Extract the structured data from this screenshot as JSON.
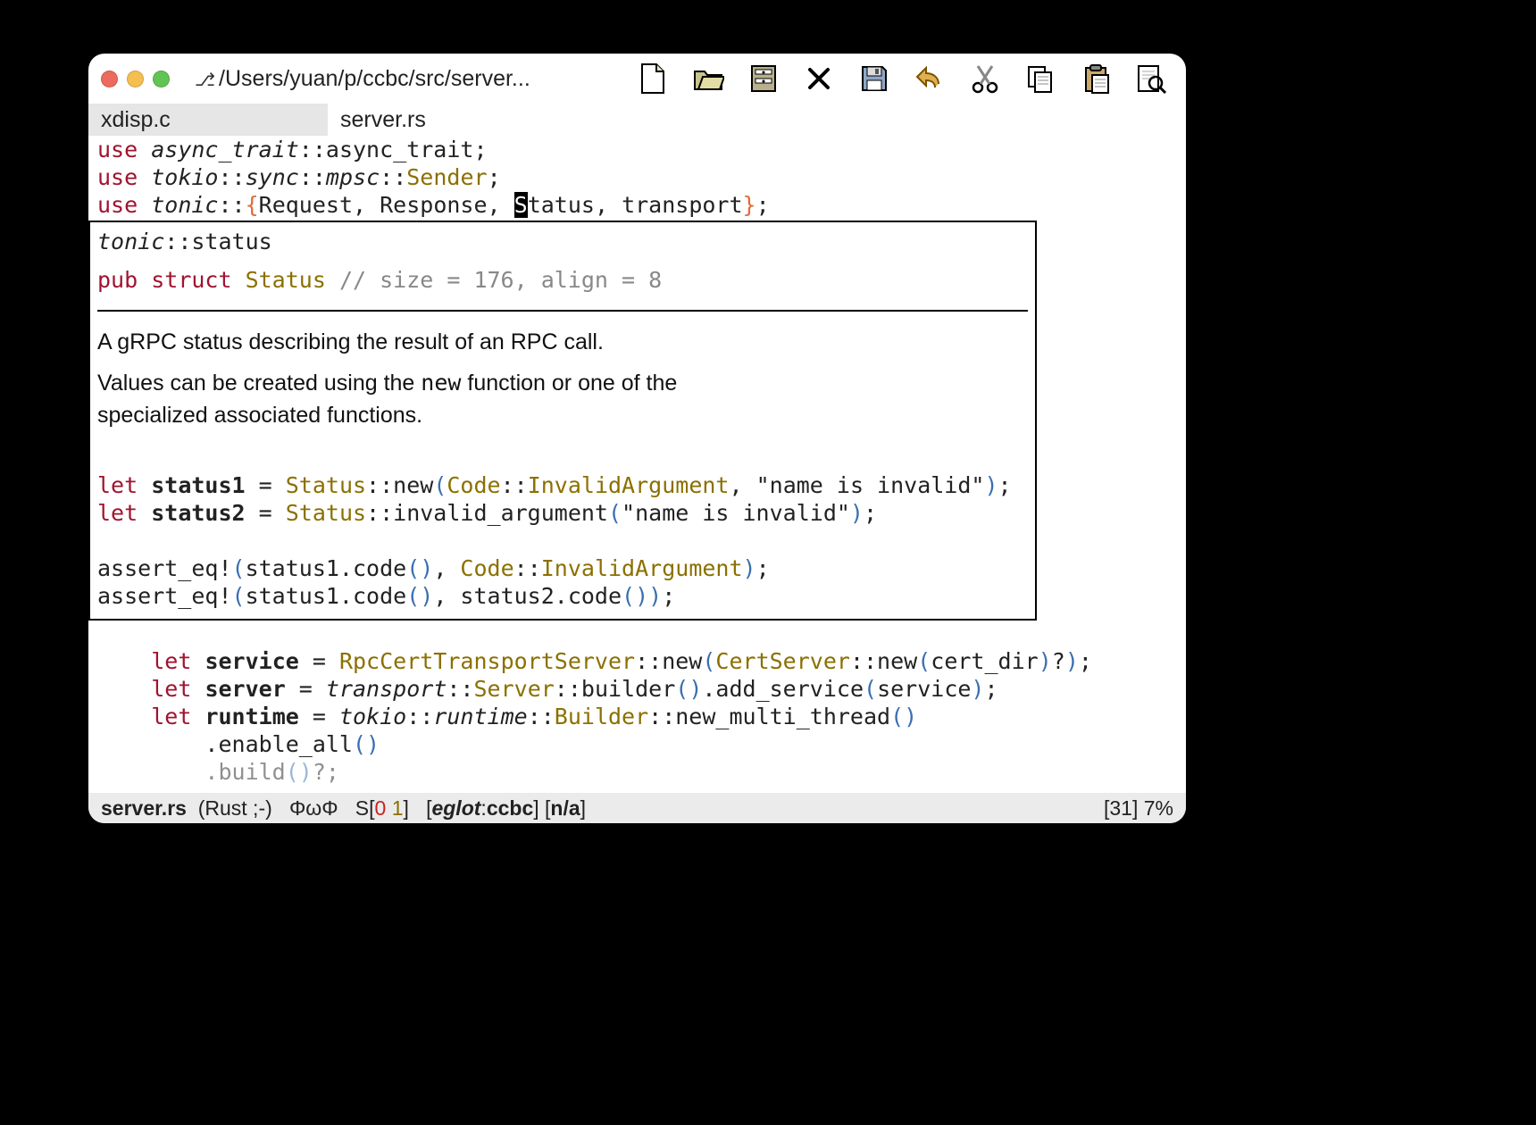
{
  "window": {
    "vc_glyph": "⎇",
    "title_path": "/Users/yuan/p/ccbc/src/server..."
  },
  "toolbar": {
    "new": "New",
    "open": "Open",
    "dir": "Dir",
    "close": "Close",
    "save": "Save",
    "undo": "Undo",
    "cut": "Cut",
    "copy": "Copy",
    "paste": "Paste",
    "find": "Find"
  },
  "tabs": [
    {
      "label": "xdisp.c",
      "active": false
    },
    {
      "label": "server.rs",
      "active": true
    }
  ],
  "code_top": [
    {
      "kw": "use ",
      "mod": "async_trait",
      "rest": "::async_trait;"
    },
    {
      "kw": "use ",
      "mod": "tokio",
      "rest1": "::",
      "mod2": "sync",
      "rest2": "::",
      "mod3": "mpsc",
      "rest3": "::",
      "type": "Sender",
      "end": ";"
    },
    {
      "kw": "use ",
      "mod": "tonic",
      "rest1": "::",
      "braceL": "{",
      "items_before": "Request, Response, ",
      "cursor": "S",
      "items_after": "tatus",
      "rest2": ", transport",
      "braceR": "}",
      "end": ";"
    }
  ],
  "popup": {
    "path_mod": "tonic",
    "path_sep": "::",
    "path_tail": "status",
    "decl_pub": "pub ",
    "decl_struct": "struct ",
    "decl_name": "Status ",
    "decl_comment": "// size = 176, align = 8",
    "doc1": "A gRPC status describing the result of an RPC call.",
    "doc2a": "Values can be created using the ",
    "doc2_code": "new",
    "doc2b": " function or one of the specialized associated functions.",
    "snip": {
      "l1": {
        "kw": "let ",
        "name": "status1",
        "eq": " = ",
        "ty": "Status",
        "sep": "::",
        "fn": "new",
        "p": "(",
        "ty2": "Code",
        "sep2": "::",
        "const": "InvalidArgument",
        "args": ", \"name is invalid\"",
        "pend": ")",
        "end": ";"
      },
      "l2": {
        "kw": "let ",
        "name": "status2",
        "eq": " = ",
        "ty": "Status",
        "sep": "::",
        "fn": "invalid_argument",
        "p": "(",
        "args": "\"name is invalid\"",
        "pend": ")",
        "end": ";"
      },
      "l3": {
        "mac": "assert_eq!",
        "p": "(",
        "a": "status1.code",
        "pp": "()",
        "c": ", ",
        "ty": "Code",
        "sep": "::",
        "const": "InvalidArgument",
        "pend": ")",
        "end": ";"
      },
      "l4": {
        "mac": "assert_eq!",
        "p": "(",
        "a": "status1.code",
        "pp": "()",
        "c": ", ",
        "b": "status2.code",
        "pp2": "()",
        "pend": ")",
        "end": ";"
      }
    }
  },
  "code_below": [
    {
      "indent": "    ",
      "kw": "let ",
      "name": "service",
      "eq": " = ",
      "ty": "RpcCertTransportServer",
      "sep": "::new",
      "p": "(",
      "ty2": "CertServer",
      "sep2": "::new",
      "p2": "(",
      "arg": "cert_dir",
      "p2end": ")",
      "q": "?",
      "pend": ")",
      "end": ";"
    },
    {
      "indent": "    ",
      "kw": "let ",
      "name": "server",
      "eq": " = ",
      "mod": "transport",
      "sep": "::",
      "ty": "Server",
      "sep2": "::builder",
      "pp": "()",
      "dot": ".add_service",
      "p": "(",
      "arg": "service",
      "pend": ")",
      "end": ";"
    },
    {
      "indent": "    ",
      "kw": "let ",
      "name": "runtime",
      "eq": " = ",
      "mod": "tokio",
      "sep": "::",
      "mod2": "runtime",
      "sep2": "::",
      "ty": "Builder",
      "sep3": "::new_multi_thread",
      "pp": "()"
    },
    {
      "indent": "        ",
      "dot": ".enable_all",
      "pp": "()"
    },
    {
      "indent": "        ",
      "dot": ".build",
      "pp": "()",
      "q": "?;"
    }
  ],
  "modeline": {
    "filename": "server.rs",
    "major": "(Rust ;-)",
    "phi": "ΦωΦ",
    "s": "S",
    "s_open": "[",
    "s_err": "0",
    "s_warn": "1",
    "s_close": "]",
    "eglot_open": "[",
    "eglot_name": "eglot",
    "eglot_sep": ":",
    "eglot_proj": "ccbc",
    "eglot_close": "]",
    "na": "[n/a]",
    "right_line": "[31]",
    "right_pct": " 7%"
  }
}
